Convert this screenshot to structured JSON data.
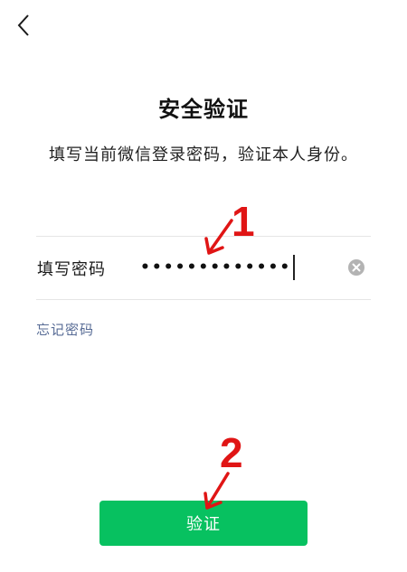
{
  "header": {
    "back_icon": "chevron-left-icon"
  },
  "page": {
    "title": "安全验证",
    "description": "填写当前微信登录密码，验证本人身份。"
  },
  "password_field": {
    "label": "填写密码",
    "value_masked": "•••••••••••••",
    "clear_icon": "clear-circle-icon"
  },
  "forgot_password_label": "忘记密码",
  "verify_button_label": "验证",
  "annotations": {
    "step1": "1",
    "step2": "2",
    "color": "#e01515"
  },
  "colors": {
    "primary_green": "#07c160",
    "link_blue": "#576b95"
  }
}
